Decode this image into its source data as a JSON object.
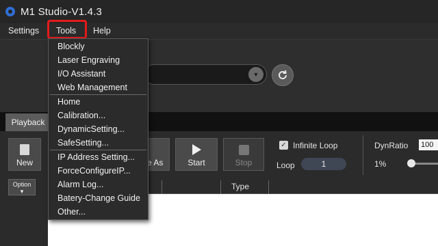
{
  "window": {
    "title": "M1 Studio-V1.4.3"
  },
  "menubar": {
    "settings": "Settings",
    "tools": "Tools",
    "help": "Help"
  },
  "tools_menu": {
    "items": [
      "Blockly",
      "Laser Engraving",
      "I/O Assistant",
      "Web Management",
      "Home",
      "Calibration...",
      "DynamicSetting...",
      "SafeSetting...",
      "IP Address Setting...",
      "ForceConfigureIP...",
      "Alarm Log...",
      "Batery-Change Guide",
      "Other..."
    ]
  },
  "tabs": {
    "playback": "Playback"
  },
  "toolbar": {
    "new_label": "New",
    "saveas_label": "e As",
    "start_label": "Start",
    "stop_label": "Stop",
    "option_label": "Option",
    "option_arrow": "▾",
    "infinite_loop_label": "Infinite Loop",
    "infinite_loop_checked": true,
    "loop_label": "Loop",
    "loop_value": "1",
    "dyn_ratio_label": "DynRatio",
    "dyn_ratio_value": "100",
    "dyn_ratio_min": "1%"
  },
  "table": {
    "columns": [
      "Type"
    ]
  },
  "colors": {
    "highlight": "#e51b1b",
    "accent_logo": "#2f6fd6"
  }
}
